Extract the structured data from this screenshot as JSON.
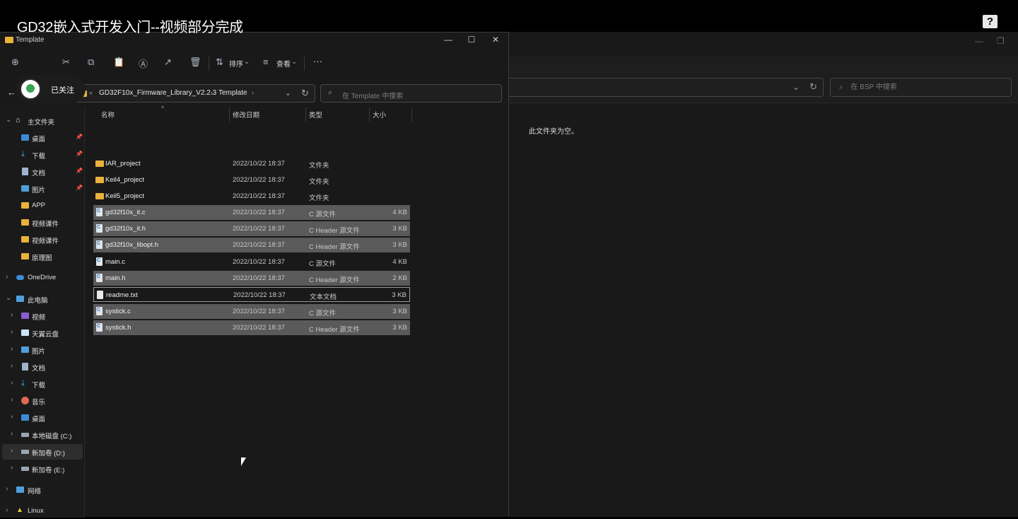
{
  "video": {
    "title": "GD32嵌入式开发入门--视频部分完成",
    "help_label": "?",
    "follow_label": "已关注"
  },
  "bg_window": {
    "search_placeholder": "在 BSP 中搜索",
    "empty_message": "此文件夹为空。"
  },
  "window": {
    "title": "Template",
    "minimize": "—",
    "maximize": "☐",
    "close": "✕"
  },
  "toolbar": {
    "sort_label": "排序",
    "view_label": "查看",
    "more_label": "···"
  },
  "address": {
    "overflow": "«",
    "crumbs": [
      "GD32F10x_Firmware_Library_V2.2.3",
      "Template"
    ],
    "search_placeholder": "在 Template 中搜索"
  },
  "sidebar": {
    "home": "主文件夹",
    "pinned": [
      "桌面",
      "下载",
      "文档",
      "图片"
    ],
    "folders": [
      "APP",
      "视频课件",
      "视频课件",
      "原理图"
    ],
    "onedrive": "OneDrive",
    "this_pc": "此电脑",
    "pc_items": [
      "视频",
      "天翼云盘",
      "图片",
      "文档",
      "下载",
      "音乐",
      "桌面",
      "本地磁盘 (C:)",
      "新加卷 (D:)",
      "新加卷 (E:)"
    ],
    "network": "网络",
    "linux": "Linux"
  },
  "columns": {
    "name": "名称",
    "date": "修改日期",
    "type": "类型",
    "size": "大小"
  },
  "files": [
    {
      "name": "IAR_project",
      "date": "2022/10/22 18:37",
      "type": "文件夹",
      "size": ""
    },
    {
      "name": "Keil4_project",
      "date": "2022/10/22 18:37",
      "type": "文件夹",
      "size": ""
    },
    {
      "name": "Keil5_project",
      "date": "2022/10/22 18:37",
      "type": "文件夹",
      "size": ""
    },
    {
      "name": "gd32f10x_it.c",
      "date": "2022/10/22 18:37",
      "type": "C 源文件",
      "size": "4 KB"
    },
    {
      "name": "gd32f10x_it.h",
      "date": "2022/10/22 18:37",
      "type": "C Header 源文件",
      "size": "3 KB"
    },
    {
      "name": "gd32f10x_libopt.h",
      "date": "2022/10/22 18:37",
      "type": "C Header 源文件",
      "size": "3 KB"
    },
    {
      "name": "main.c",
      "date": "2022/10/22 18:37",
      "type": "C 源文件",
      "size": "4 KB"
    },
    {
      "name": "main.h",
      "date": "2022/10/22 18:37",
      "type": "C Header 源文件",
      "size": "2 KB"
    },
    {
      "name": "readme.txt",
      "date": "2022/10/22 18:37",
      "type": "文本文档",
      "size": "3 KB"
    },
    {
      "name": "systick.c",
      "date": "2022/10/22 18:37",
      "type": "C 源文件",
      "size": "3 KB"
    },
    {
      "name": "systick.h",
      "date": "2022/10/22 18:37",
      "type": "C Header 源文件",
      "size": "3 KB"
    }
  ]
}
